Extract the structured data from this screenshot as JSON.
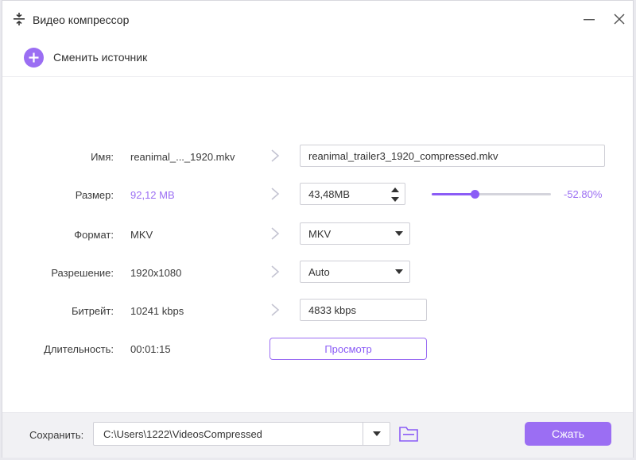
{
  "window": {
    "title": "Видео компрессор",
    "accent_color": "#9b6ef3"
  },
  "toolbar": {
    "change_source_label": "Сменить источник",
    "change_source_icon": "plus-circle-icon"
  },
  "form": {
    "name": {
      "label": "Имя:",
      "source": "reanimal_..._1920.mkv",
      "output": "reanimal_trailer3_1920_compressed.mkv"
    },
    "size": {
      "label": "Размер:",
      "source": "92,12 MB",
      "output": "43,48MB",
      "slider_fraction": 0.36,
      "percent": "-52.80%"
    },
    "format": {
      "label": "Формат:",
      "source": "MKV",
      "selected": "MKV"
    },
    "resolution": {
      "label": "Разрешение:",
      "source": "1920x1080",
      "selected": "Auto"
    },
    "bitrate": {
      "label": "Битрейт:",
      "source": "10241 kbps",
      "output": "4833 kbps"
    },
    "duration": {
      "label": "Длительность:",
      "source": "00:01:15"
    },
    "preview_label": "Просмотр"
  },
  "footer": {
    "save_label": "Сохранить:",
    "save_path": "C:\\Users\\1222\\VideosCompressed",
    "compress_label": "Сжать"
  }
}
